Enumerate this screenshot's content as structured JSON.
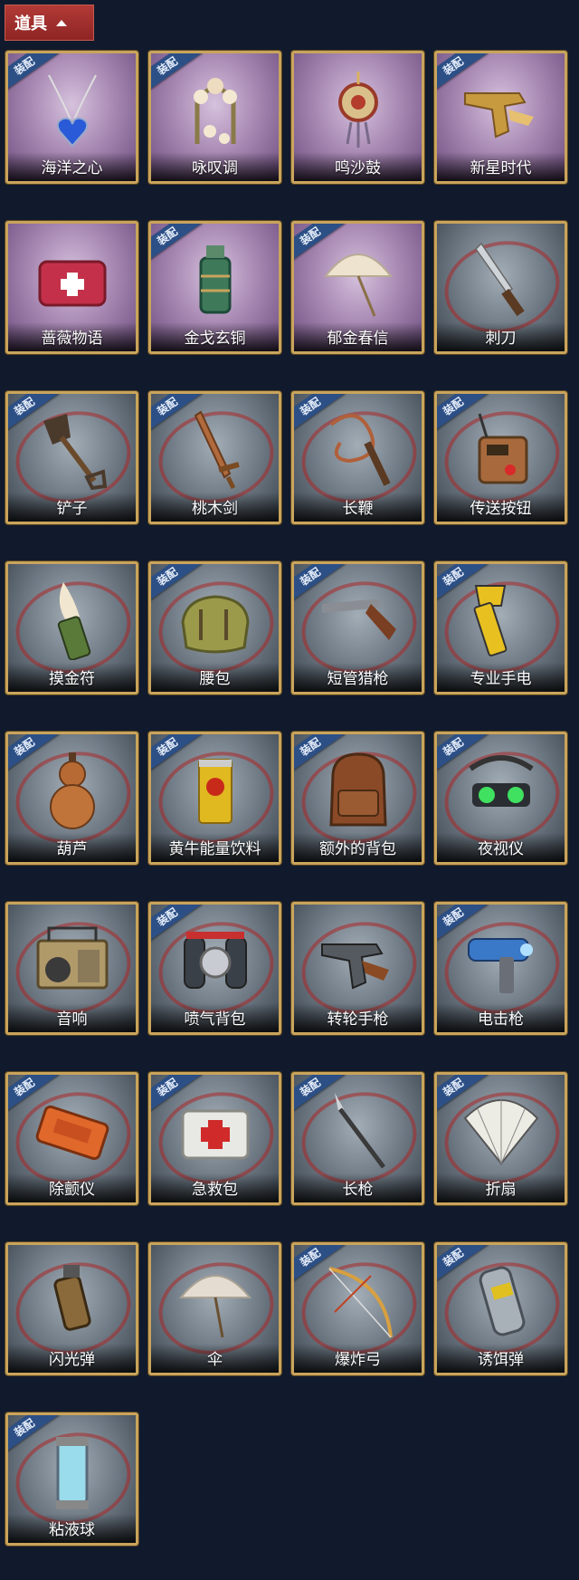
{
  "header": {
    "title": "道具",
    "toggle_icon": "chevron-up-icon"
  },
  "equip_label": "装配",
  "items": [
    {
      "name": "海洋之心",
      "equipped": true,
      "rare": true,
      "icon": "heart-necklace-icon"
    },
    {
      "name": "咏叹调",
      "equipped": true,
      "rare": true,
      "icon": "flower-arch-icon"
    },
    {
      "name": "鸣沙鼓",
      "equipped": false,
      "rare": true,
      "icon": "drum-pendant-icon"
    },
    {
      "name": "新星时代",
      "equipped": true,
      "rare": true,
      "icon": "revolver-gold-icon"
    },
    {
      "name": "蔷薇物语",
      "equipped": false,
      "rare": true,
      "icon": "medkit-box-icon"
    },
    {
      "name": "金戈玄铜",
      "equipped": true,
      "rare": true,
      "icon": "grenade-bronze-icon"
    },
    {
      "name": "郁金春信",
      "equipped": true,
      "rare": true,
      "icon": "parasol-icon"
    },
    {
      "name": "刺刀",
      "equipped": false,
      "rare": false,
      "icon": "knife-icon"
    },
    {
      "name": "铲子",
      "equipped": true,
      "rare": false,
      "icon": "shovel-icon"
    },
    {
      "name": "桃木剑",
      "equipped": true,
      "rare": false,
      "icon": "wood-sword-icon"
    },
    {
      "name": "长鞭",
      "equipped": true,
      "rare": false,
      "icon": "whip-icon"
    },
    {
      "name": "传送按钮",
      "equipped": true,
      "rare": false,
      "icon": "teleport-remote-icon"
    },
    {
      "name": "摸金符",
      "equipped": false,
      "rare": false,
      "icon": "tooth-amulet-icon"
    },
    {
      "name": "腰包",
      "equipped": true,
      "rare": false,
      "icon": "waist-bag-icon"
    },
    {
      "name": "短管猎枪",
      "equipped": true,
      "rare": false,
      "icon": "shotgun-icon"
    },
    {
      "name": "专业手电",
      "equipped": true,
      "rare": false,
      "icon": "flashlight-icon"
    },
    {
      "name": "葫芦",
      "equipped": true,
      "rare": false,
      "icon": "gourd-icon"
    },
    {
      "name": "黄牛能量饮料",
      "equipped": true,
      "rare": false,
      "icon": "energy-can-icon"
    },
    {
      "name": "额外的背包",
      "equipped": true,
      "rare": false,
      "icon": "backpack-icon"
    },
    {
      "name": "夜视仪",
      "equipped": true,
      "rare": false,
      "icon": "night-vision-icon"
    },
    {
      "name": "音响",
      "equipped": false,
      "rare": false,
      "icon": "boombox-icon"
    },
    {
      "name": "喷气背包",
      "equipped": true,
      "rare": false,
      "icon": "jetpack-icon"
    },
    {
      "name": "转轮手枪",
      "equipped": false,
      "rare": false,
      "icon": "revolver-icon"
    },
    {
      "name": "电击枪",
      "equipped": true,
      "rare": false,
      "icon": "taser-gun-icon"
    },
    {
      "name": "除颤仪",
      "equipped": true,
      "rare": false,
      "icon": "defibrillator-icon"
    },
    {
      "name": "急救包",
      "equipped": true,
      "rare": false,
      "icon": "first-aid-kit-icon"
    },
    {
      "name": "长枪",
      "equipped": true,
      "rare": false,
      "icon": "spear-icon"
    },
    {
      "name": "折扇",
      "equipped": true,
      "rare": false,
      "icon": "folding-fan-icon"
    },
    {
      "name": "闪光弹",
      "equipped": false,
      "rare": false,
      "icon": "flashbang-icon"
    },
    {
      "name": "伞",
      "equipped": false,
      "rare": false,
      "icon": "umbrella-icon"
    },
    {
      "name": "爆炸弓",
      "equipped": true,
      "rare": false,
      "icon": "bow-icon"
    },
    {
      "name": "诱饵弹",
      "equipped": true,
      "rare": false,
      "icon": "decoy-canister-icon"
    },
    {
      "name": "粘液球",
      "equipped": true,
      "rare": false,
      "icon": "slime-vial-icon"
    }
  ]
}
